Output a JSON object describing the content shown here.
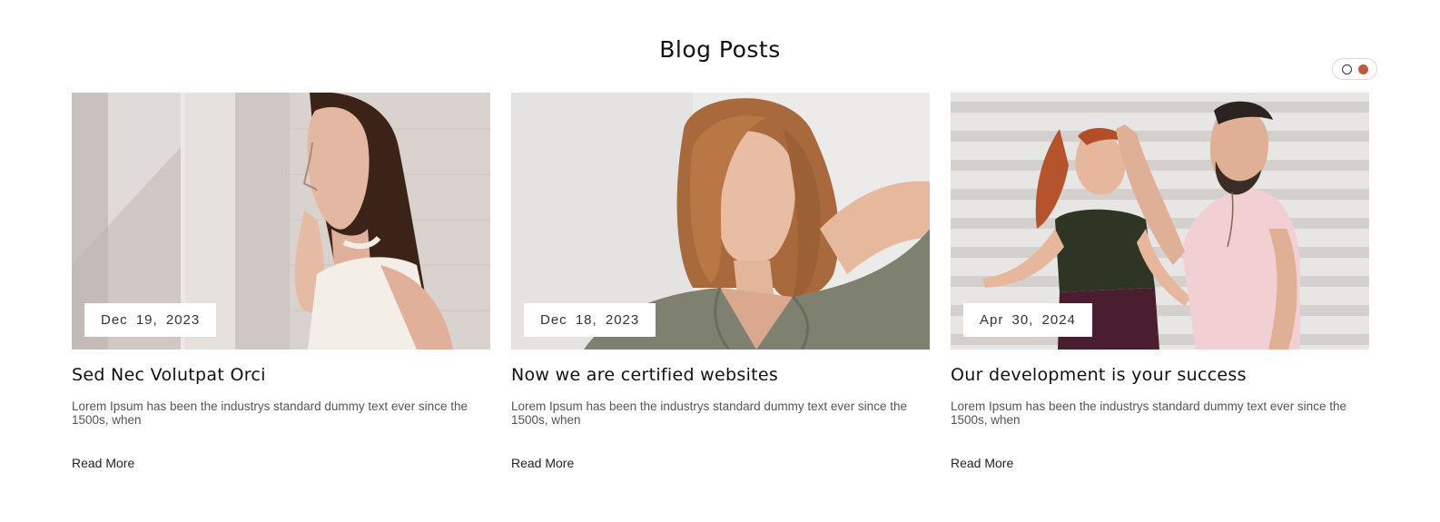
{
  "section": {
    "title": "Blog Posts"
  },
  "pager": {
    "pages": 2,
    "active_index": 1,
    "colors": {
      "active": "#c0593f",
      "inactive": "#ffffff"
    }
  },
  "posts": [
    {
      "date": "Dec  19,  2023",
      "title": "Sed Nec Volutpat Orci",
      "excerpt": "Lorem Ipsum has been the industrys standard dummy text ever since the 1500s, when",
      "read_more": "Read More",
      "image": "woman-white-top-brick-wall-photo"
    },
    {
      "date": "Dec  18,  2023",
      "title": "Now we are certified websites",
      "excerpt": "Lorem Ipsum has been the industrys standard dummy text ever since the 1500s, when",
      "read_more": "Read More",
      "image": "woman-olive-shirt-portrait-photo"
    },
    {
      "date": "Apr  30,  2024",
      "title": "Our development is your success",
      "excerpt": "Lorem Ipsum has been the industrys standard dummy text ever since the 1500s, when",
      "read_more": "Read More",
      "image": "couple-laughing-wall-photo"
    }
  ]
}
